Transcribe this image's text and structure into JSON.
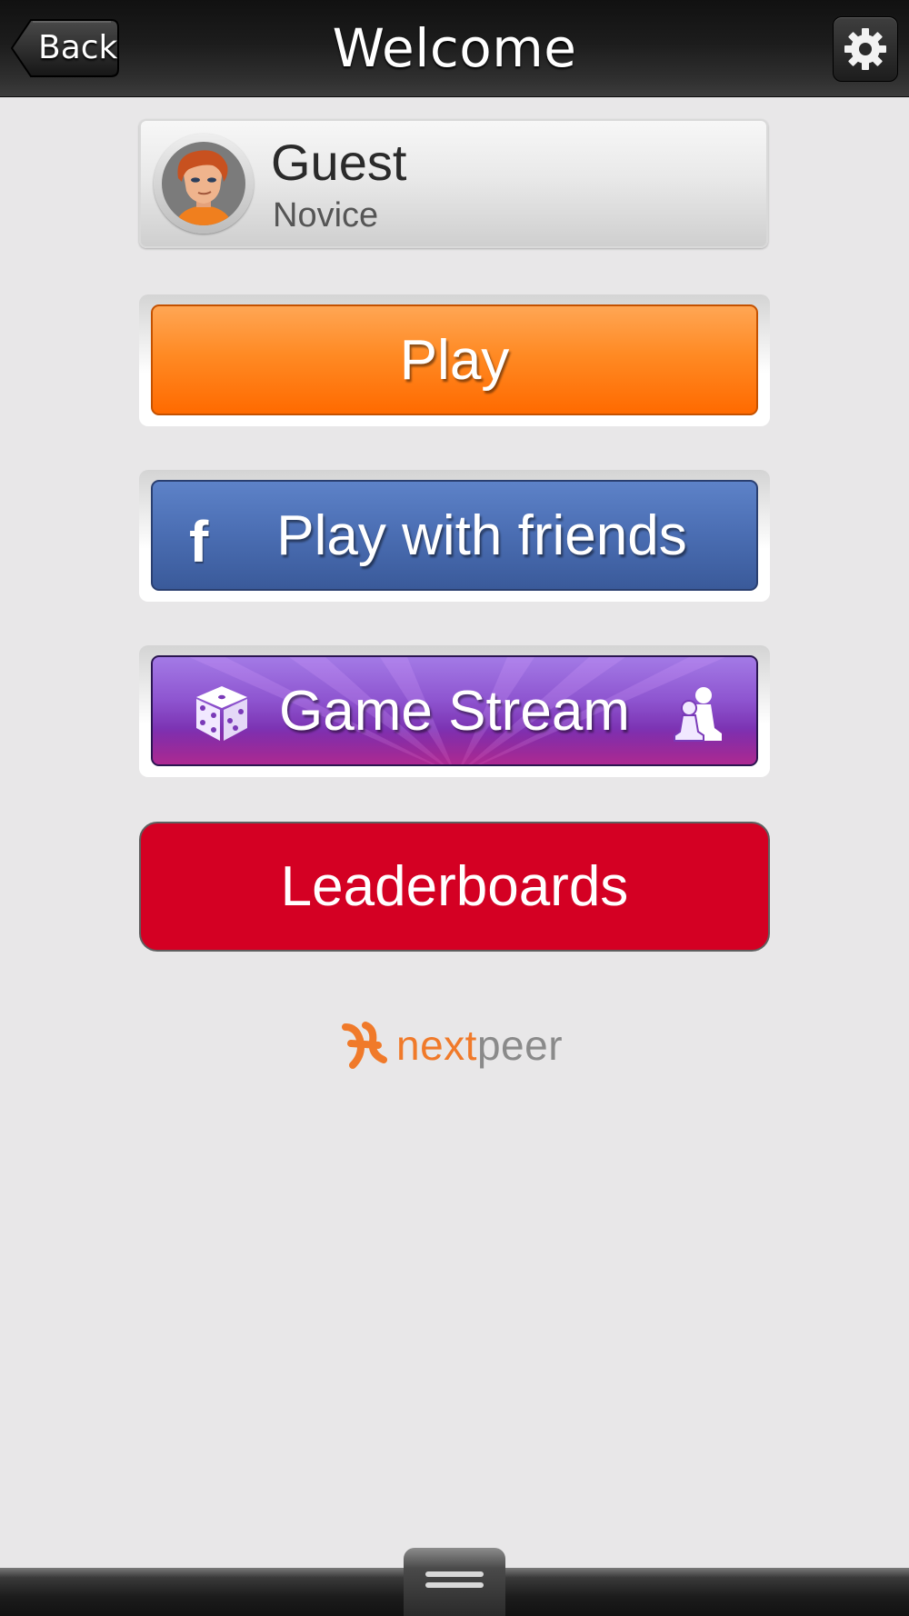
{
  "header": {
    "title": "Welcome",
    "back_label": "Back"
  },
  "profile": {
    "name": "Guest",
    "rank": "Novice"
  },
  "buttons": {
    "play_label": "Play",
    "friends_label": "Play with friends",
    "facebook_glyph": "f",
    "stream_label": "Game Stream",
    "leaderboards_label": "Leaderboards"
  },
  "branding": {
    "logo_next": "next",
    "logo_peer": "peer"
  },
  "colors": {
    "play": "#ff7a10",
    "friends": "#4a6db2",
    "stream": "#8e55d0",
    "leaderboards": "#d40023",
    "logo_accent": "#f07a2a"
  },
  "icons": [
    "settings-gear-icon",
    "avatar",
    "facebook-icon",
    "dice-icon",
    "pawns-icon",
    "nextpeer-logo-icon",
    "drawer-handle-icon"
  ]
}
